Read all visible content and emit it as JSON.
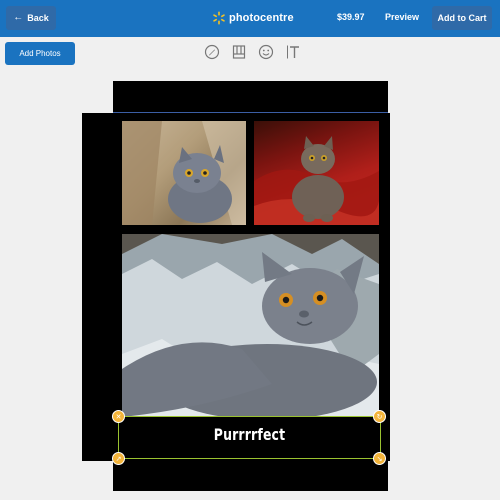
{
  "header": {
    "back_label": "Back",
    "brand": "photocentre",
    "price": "$39.97",
    "preview_label": "Preview",
    "add_to_cart_label": "Add to Cart"
  },
  "toolbar": {
    "add_photos_label": "Add Photos",
    "tools": [
      "edit-icon",
      "layout-icon",
      "sticker-icon",
      "text-icon"
    ]
  },
  "canvas": {
    "caption_text": "Purrrrfect"
  },
  "colors": {
    "header": "#1a73c0",
    "button": "#2f6aa8",
    "canvas": "#000000",
    "selection": "#9ac230",
    "handle": "#f3b43a"
  }
}
